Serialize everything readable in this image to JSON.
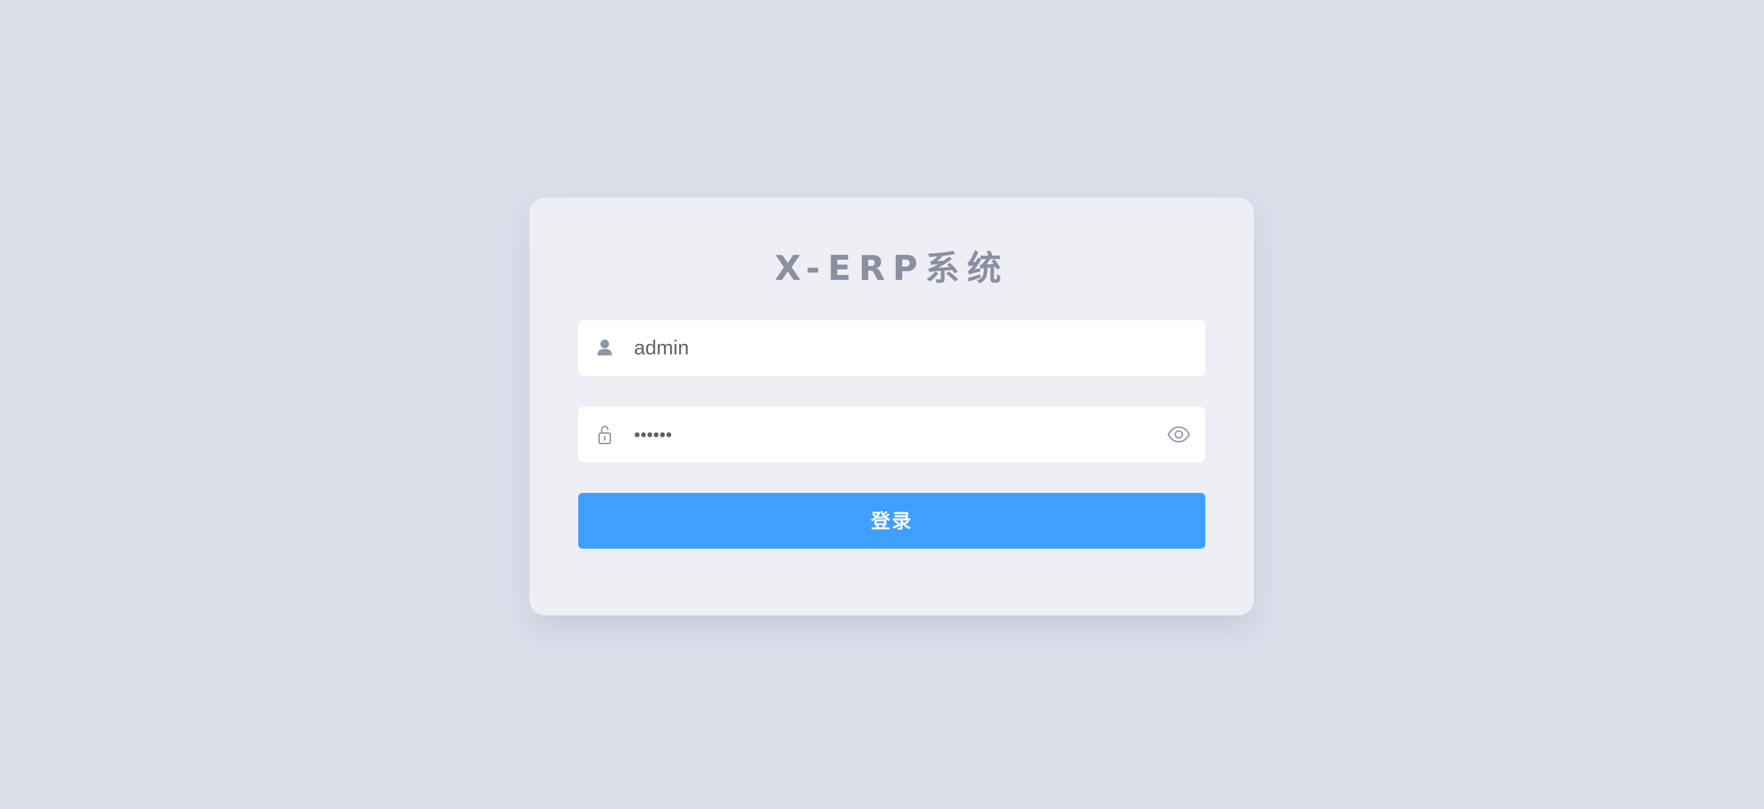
{
  "login": {
    "title": "X-ERP系统",
    "username": {
      "icon": "user-icon",
      "value": "admin"
    },
    "password": {
      "icon": "lock-icon",
      "value": "••••••",
      "toggle_icon": "eye-icon"
    },
    "submit_label": "登录"
  },
  "colors": {
    "background": "#dbe0eb",
    "card": "#edeff4",
    "primary": "#409eff",
    "title": "#8c8ea2",
    "icon": "#8a98a3"
  }
}
